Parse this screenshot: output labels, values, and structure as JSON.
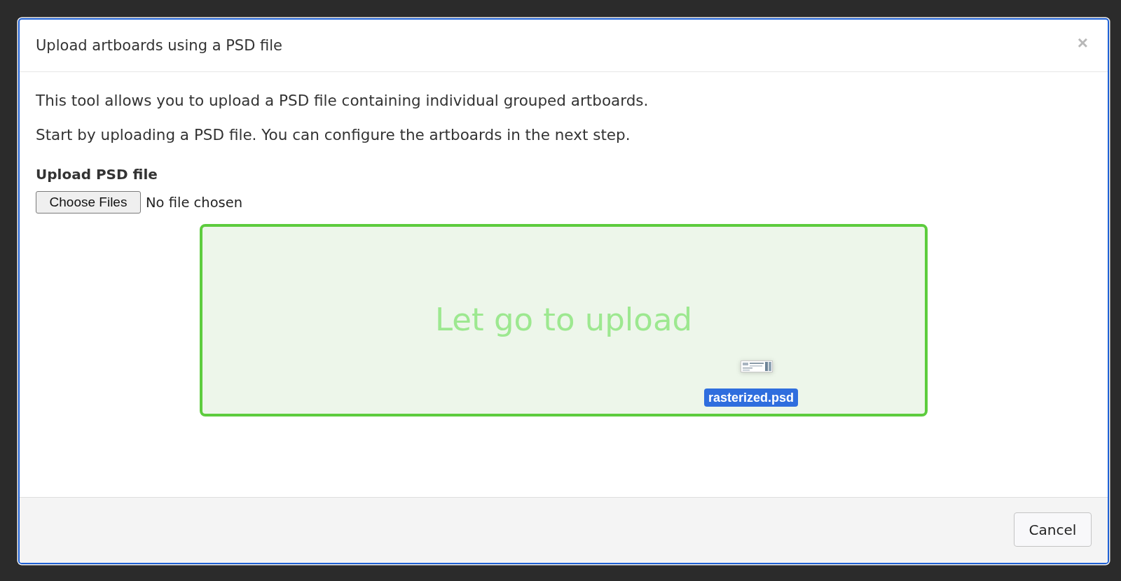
{
  "dialog": {
    "title": "Upload artboards using a PSD file",
    "close_label": "×"
  },
  "body": {
    "paragraphs": [
      "This tool allows you to upload a PSD file containing individual grouped artboards.",
      "Start by uploading a PSD file. You can configure the artboards in the next step."
    ],
    "upload_field": {
      "label": "Upload PSD file",
      "button": "Choose Files",
      "status": "No file chosen"
    },
    "dropzone": {
      "message": "Let go to upload",
      "drag_over": true,
      "dragged_file": {
        "name": "rasterized.psd"
      }
    }
  },
  "footer": {
    "buttons": [
      {
        "label": "Cancel"
      }
    ]
  }
}
